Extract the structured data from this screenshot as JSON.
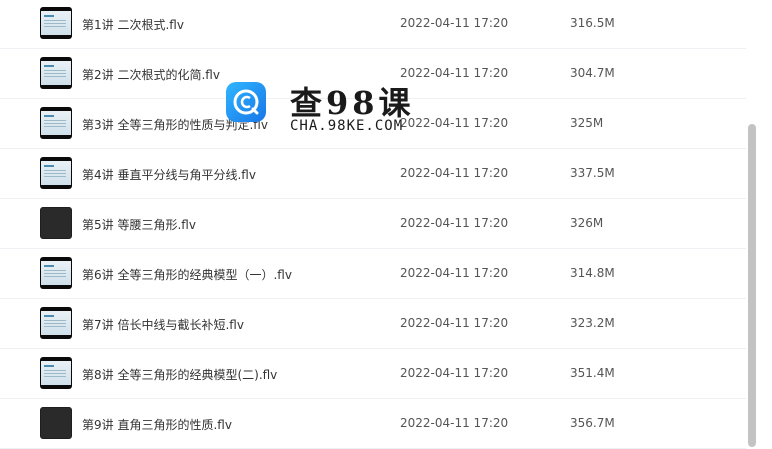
{
  "files": [
    {
      "name": "第1讲 二次根式.flv",
      "date": "2022-04-11 17:20",
      "size": "316.5M",
      "thumb": "slide-icon"
    },
    {
      "name": "第2讲 二次根式的化简.flv",
      "date": "2022-04-11 17:20",
      "size": "304.7M",
      "thumb": "slide-icon"
    },
    {
      "name": "第3讲 全等三角形的性质与判定.flv",
      "date": "2022-04-11 17:20",
      "size": "325M",
      "thumb": "slide-icon"
    },
    {
      "name": "第4讲 垂直平分线与角平分线.flv",
      "date": "2022-04-11 17:20",
      "size": "337.5M",
      "thumb": "slide-icon"
    },
    {
      "name": "第5讲 等腰三角形.flv",
      "date": "2022-04-11 17:20",
      "size": "326M",
      "thumb": "dark-video-icon"
    },
    {
      "name": "第6讲 全等三角形的经典模型（一）.flv",
      "date": "2022-04-11 17:20",
      "size": "314.8M",
      "thumb": "slide-icon"
    },
    {
      "name": "第7讲 倍长中线与截长补短.flv",
      "date": "2022-04-11 17:20",
      "size": "323.2M",
      "thumb": "slide-icon"
    },
    {
      "name": "第8讲 全等三角形的经典模型(二).flv",
      "date": "2022-04-11 17:20",
      "size": "351.4M",
      "thumb": "slide-icon"
    },
    {
      "name": "第9讲 直角三角形的性质.flv",
      "date": "2022-04-11 17:20",
      "size": "356.7M",
      "thumb": "dark-video-icon"
    }
  ],
  "watermark": {
    "title": "查98课",
    "subtitle": "CHA.98KE.COM",
    "logo_icon": "c-logo-icon",
    "logo_color": "#1e8cf0"
  },
  "colors": {
    "row_border": "#eef0f3",
    "scrollbar": "#c3c3c3"
  }
}
